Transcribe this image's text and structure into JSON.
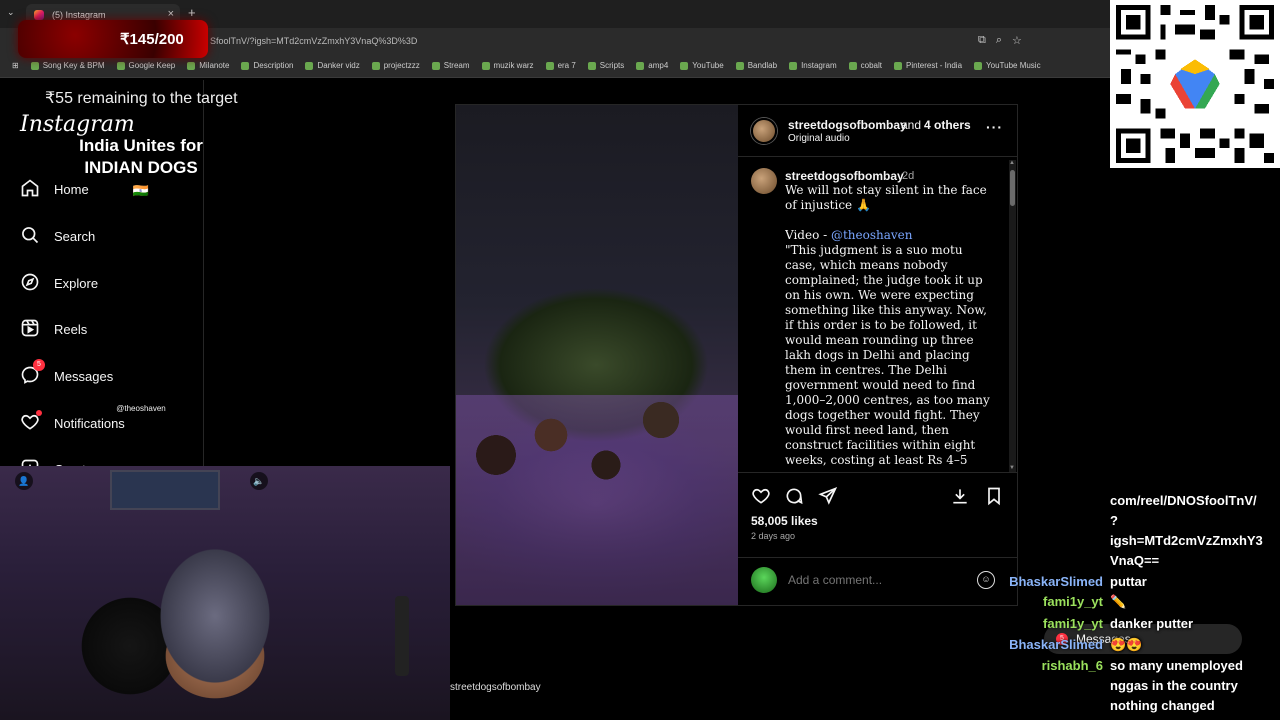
{
  "browser": {
    "tab_title": "(5) Instagram",
    "url": "SfoolTnV/?igsh=MTd2cmVzZmxhY3VnaQ%3D%3D",
    "bookmarks": [
      "Song Key & BPM",
      "Google Keep",
      "Milanote",
      "Description",
      "Danker vidz",
      "projectzzz",
      "Stream",
      "muzik warz",
      "era 7",
      "Scripts",
      "amp4",
      "YouTube",
      "Bandlab",
      "Instagram",
      "cobalt",
      "Pinterest - India",
      "YouTube Music"
    ]
  },
  "overlay": {
    "goal": "₹145/200",
    "remaining": "₹55 remaining to the target"
  },
  "sidebar": {
    "logo": "Instagram",
    "items": [
      {
        "label": "Home"
      },
      {
        "label": "Search"
      },
      {
        "label": "Explore"
      },
      {
        "label": "Reels"
      },
      {
        "label": "Messages",
        "badge": "5"
      },
      {
        "label": "Notifications"
      },
      {
        "label": "Create"
      }
    ]
  },
  "post": {
    "video_title_line1": "India Unites for",
    "video_title_line2": "INDIAN DOGS",
    "video_flag": "🇮🇳",
    "video_credit": "@theoshaven",
    "header_user": "streetdogsofbombay",
    "header_and": "and",
    "header_others": "4 others",
    "header_audio": "Original audio",
    "caption_user": "streetdogsofbombay",
    "caption_time": "2d",
    "caption_intro": "We will not stay silent in the face of injustice 🙏",
    "caption_video_label": "Video - ",
    "caption_video_mention": "@theoshaven",
    "caption_body": "\"This judgment is a suo motu case, which means nobody complained; the judge took it up on his own. We were expecting something like this anyway. Now, if this order is to be followed, it would mean rounding up three lakh dogs in Delhi and placing them in centres. The Delhi government would need to find 1,000–2,000 centres, as too many dogs together would fight. They would first need land, then construct facilities within eight weeks, costing at least Rs 4–5 crore, with caretakers, feeders, and watchmen to prevent escapes. This judgment seems to lack rational thought and sense of",
    "likes": "58,005 likes",
    "ago": "2 days ago",
    "comment_placeholder": "Add a comment...",
    "bottom_user": "streetdogsofbombay",
    "messages_label": "Messages",
    "messages_count": "5"
  },
  "chat": [
    {
      "name": "",
      "message": "com/reel/DNOSfoolTnV/",
      "name_color": "#ffffff"
    },
    {
      "name": "",
      "message": "?",
      "name_color": "#ffffff"
    },
    {
      "name": "",
      "message": "igsh=MTd2cmVzZmxhY3",
      "name_color": "#ffffff"
    },
    {
      "name": "",
      "message": "VnaQ==",
      "name_color": "#ffffff"
    },
    {
      "name": "BhaskarSlimed",
      "message": "puttar",
      "name_color": "#8ab4f8"
    },
    {
      "name": "fami1y_yt",
      "message": "✏️",
      "name_color": "#9be15d"
    },
    {
      "name": "fami1y_yt",
      "message": "danker putter",
      "name_color": "#9be15d"
    },
    {
      "name": "BhaskarSlimed",
      "message": "😍😍",
      "name_color": "#8ab4f8"
    },
    {
      "name": "rishabh_6",
      "message": "so many unemployed",
      "name_color": "#9be15d"
    },
    {
      "name": "",
      "message": "nggas in the country",
      "name_color": "#ffffff"
    },
    {
      "name": "",
      "message": "nothing changed",
      "name_color": "#ffffff"
    }
  ],
  "colors": {
    "ig_background": "#000000",
    "mention": "#7aa6ff",
    "badge": "#ff3040",
    "chat_blue": "#8ab4f8",
    "chat_green": "#9be15d"
  }
}
